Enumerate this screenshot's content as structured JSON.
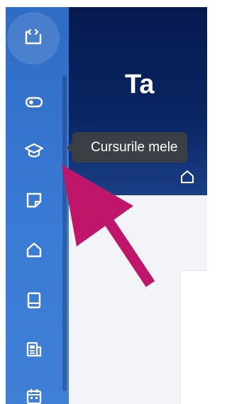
{
  "page": {
    "title": "Ta",
    "breadcrumb_icon": "home-icon"
  },
  "sidebar": {
    "logo_icon": "sidebar-toggle-icon",
    "items": [
      {
        "id": "toggle",
        "icon": "toggle-icon"
      },
      {
        "id": "my-courses",
        "icon": "graduation-cap-icon"
      },
      {
        "id": "notes",
        "icon": "sticky-note-icon"
      },
      {
        "id": "home",
        "icon": "home-icon"
      },
      {
        "id": "book",
        "icon": "book-icon"
      },
      {
        "id": "news",
        "icon": "newspaper-icon"
      },
      {
        "id": "calendar",
        "icon": "calendar-icon"
      }
    ]
  },
  "tooltip": {
    "text": "Cursurile mele"
  },
  "colors": {
    "sidebar": "#3a7bd5",
    "header": "#0a2563",
    "tooltip": "#3a3f45",
    "annotation_arrow": "#c0166a",
    "icon": "#ffffff"
  }
}
